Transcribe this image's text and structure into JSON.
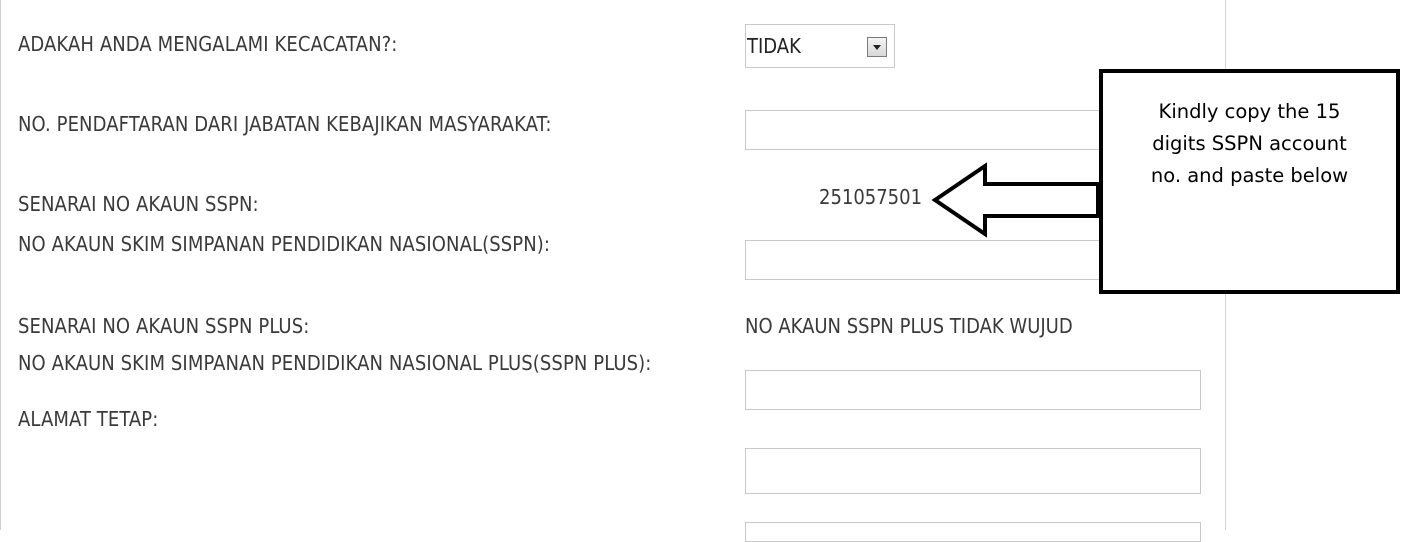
{
  "form": {
    "disability": {
      "label": "ADAKAH ANDA MENGALAMI KECACATAN?:",
      "value": "TIDAK"
    },
    "jkm_registration": {
      "label": "NO. PENDAFTARAN DARI JABATAN KEBAJIKAN MASYARAKAT:",
      "value": ""
    },
    "sspn_list": {
      "label": "SENARAI NO AKAUN SSPN:",
      "value": "251057501"
    },
    "sspn_account": {
      "label": "NO AKAUN SKIM SIMPANAN PENDIDIKAN NASIONAL(SSPN):",
      "value": ""
    },
    "sspn_plus_list": {
      "label": "SENARAI NO AKAUN SSPN PLUS:",
      "value": "NO AKAUN SSPN PLUS TIDAK WUJUD"
    },
    "sspn_plus_account": {
      "label": "NO AKAUN SKIM SIMPANAN PENDIDIKAN NASIONAL PLUS(SSPN PLUS):",
      "value": ""
    },
    "permanent_address": {
      "label": "ALAMAT TETAP:",
      "value": ""
    }
  },
  "annotation": {
    "lines": [
      "Kindly copy the 15",
      "digits SSPN account",
      "no. and paste below"
    ]
  },
  "icons": {
    "select_arrow": "chevron-down-icon",
    "pointer": "left-arrow-icon"
  }
}
